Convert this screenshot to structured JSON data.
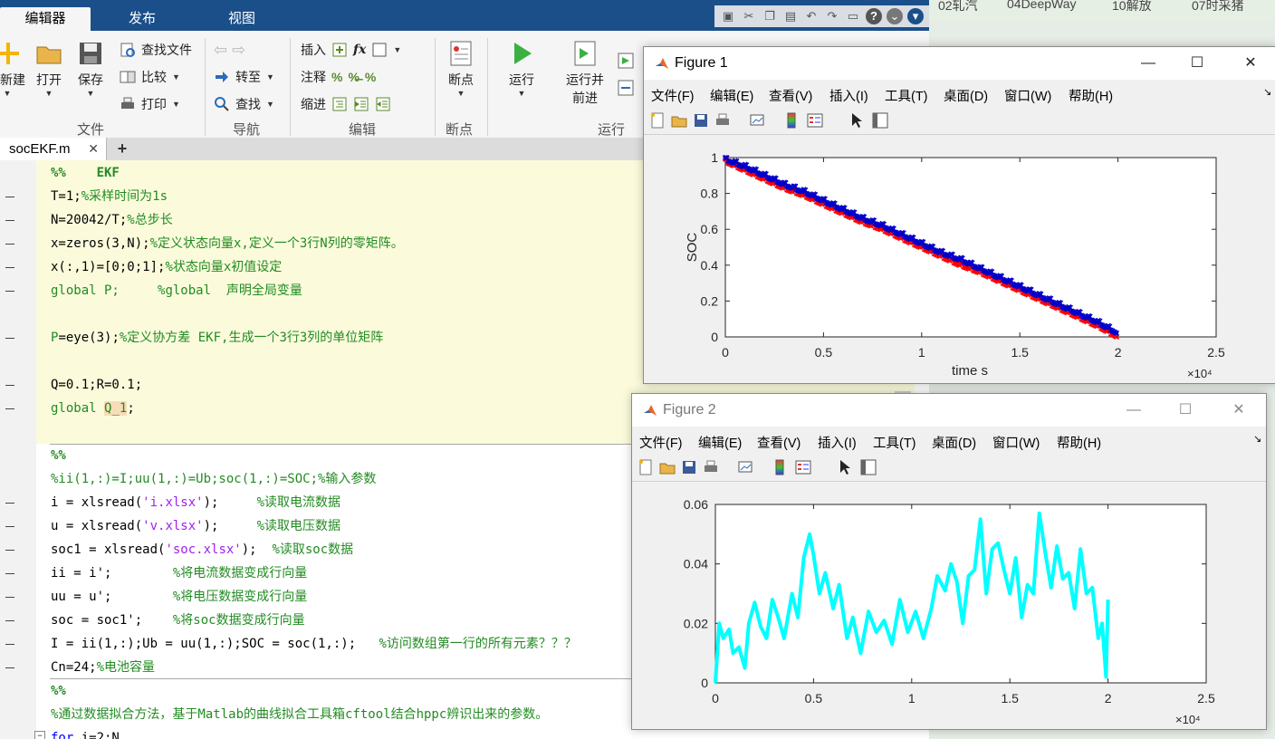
{
  "ribbon": {
    "tabs": [
      "编辑器",
      "发布",
      "视图"
    ],
    "file_group": {
      "new": "新建",
      "open": "打开",
      "save": "保存",
      "find_files": "查找文件",
      "compare": "比较",
      "print": "打印",
      "label": "文件"
    },
    "nav_group": {
      "goto": "转至",
      "find": "查找",
      "label": "导航"
    },
    "edit_group": {
      "insert": "插入",
      "comment": "注释",
      "indent": "缩进",
      "label": "编辑",
      "fx": "fx"
    },
    "bp_group": {
      "breakpoints": "断点",
      "label": "断点"
    },
    "run_group": {
      "run": "运行",
      "run_advance_1": "运行并",
      "run_advance_2": "前进",
      "label": "运行"
    }
  },
  "editor": {
    "file_tab": "socEKF.m",
    "add_tab": "+",
    "lines": [
      {
        "segments": [
          {
            "t": "%%    EKF",
            "c": "cmt bold"
          }
        ],
        "dash": false
      },
      {
        "segments": [
          {
            "t": "T=1;",
            "c": ""
          },
          {
            "t": "%采样时间为1s",
            "c": "cmt"
          }
        ],
        "dash": true
      },
      {
        "segments": [
          {
            "t": "N=20042/T;",
            "c": ""
          },
          {
            "t": "%总步长",
            "c": "cmt"
          }
        ],
        "dash": true
      },
      {
        "segments": [
          {
            "t": "x=zeros(3,N);",
            "c": ""
          },
          {
            "t": "%定义状态向量x,定义一个3行N列的零矩阵。",
            "c": "cmt"
          }
        ],
        "dash": true
      },
      {
        "segments": [
          {
            "t": "x(:,1)=[0;0;1];",
            "c": ""
          },
          {
            "t": "%状态向量x初值设定",
            "c": "cmt"
          }
        ],
        "dash": true
      },
      {
        "segments": [
          {
            "t": "global P;     ",
            "c": "cmt"
          },
          {
            "t": "%global  声明全局变量",
            "c": "cmt"
          }
        ],
        "dash": true
      },
      {
        "segments": [
          {
            "t": "",
            "c": ""
          }
        ],
        "dash": false
      },
      {
        "segments": [
          {
            "t": "P",
            "c": "cmt"
          },
          {
            "t": "=eye(3);",
            "c": ""
          },
          {
            "t": "%定义协方差 EKF,生成一个3行3列的单位矩阵",
            "c": "cmt"
          }
        ],
        "dash": true
      },
      {
        "segments": [
          {
            "t": "",
            "c": ""
          }
        ],
        "dash": false
      },
      {
        "segments": [
          {
            "t": "Q=0.1;R=0.1;",
            "c": ""
          }
        ],
        "dash": true
      },
      {
        "segments": [
          {
            "t": "global ",
            "c": "cmt"
          },
          {
            "t": "Q_1",
            "c": "hl"
          },
          {
            "t": ";",
            "c": ""
          }
        ],
        "dash": true
      },
      {
        "segments": [
          {
            "t": "",
            "c": ""
          }
        ],
        "dash": false
      },
      {
        "segments": [
          {
            "t": "%%",
            "c": "cmt bold"
          }
        ],
        "dash": false
      },
      {
        "segments": [
          {
            "t": "%ii(1,:)=I;uu(1,:)=Ub;soc(1,:)=SOC;%输入参数",
            "c": "cmt"
          }
        ],
        "dash": false
      },
      {
        "segments": [
          {
            "t": "i = xlsread(",
            "c": ""
          },
          {
            "t": "'i.xlsx'",
            "c": "str"
          },
          {
            "t": ");     ",
            "c": ""
          },
          {
            "t": "%读取电流数据",
            "c": "cmt"
          }
        ],
        "dash": true
      },
      {
        "segments": [
          {
            "t": "u = xlsread(",
            "c": ""
          },
          {
            "t": "'v.xlsx'",
            "c": "str"
          },
          {
            "t": ");     ",
            "c": ""
          },
          {
            "t": "%读取电压数据",
            "c": "cmt"
          }
        ],
        "dash": true
      },
      {
        "segments": [
          {
            "t": "soc1 = xlsread(",
            "c": ""
          },
          {
            "t": "'soc.xlsx'",
            "c": "str"
          },
          {
            "t": ");  ",
            "c": ""
          },
          {
            "t": "%读取soc数据",
            "c": "cmt"
          }
        ],
        "dash": true
      },
      {
        "segments": [
          {
            "t": "ii = i';        ",
            "c": ""
          },
          {
            "t": "%将电流数据变成行向量",
            "c": "cmt"
          }
        ],
        "dash": true
      },
      {
        "segments": [
          {
            "t": "uu = u';        ",
            "c": ""
          },
          {
            "t": "%将电压数据变成行向量",
            "c": "cmt"
          }
        ],
        "dash": true
      },
      {
        "segments": [
          {
            "t": "soc = soc1';    ",
            "c": ""
          },
          {
            "t": "%将soc数据变成行向量",
            "c": "cmt"
          }
        ],
        "dash": true
      },
      {
        "segments": [
          {
            "t": "I = ii(1,:);Ub = uu(1,:);SOC = soc(1,:);   ",
            "c": ""
          },
          {
            "t": "%访问数组第一行的所有元素？？？",
            "c": "cmt"
          }
        ],
        "dash": true
      },
      {
        "segments": [
          {
            "t": "Cn=24;",
            "c": ""
          },
          {
            "t": "%电池容量",
            "c": "cmt"
          }
        ],
        "dash": true
      },
      {
        "segments": [
          {
            "t": "%%",
            "c": "cmt bold"
          }
        ],
        "dash": false
      },
      {
        "segments": [
          {
            "t": "%通过数据拟合方法，基于Matlab的曲线拟合工具箱cftool结合hppc辨识出来的参数。",
            "c": "cmt"
          }
        ],
        "dash": false
      },
      {
        "segments": [
          {
            "t": "for ",
            "c": "kw"
          },
          {
            "t": "i=2:N",
            "c": ""
          }
        ],
        "dash": false
      }
    ]
  },
  "background_bar": [
    "02轧汽",
    "04DeepWay",
    "10解放",
    "07时采猪"
  ],
  "figure1": {
    "title": "Figure 1",
    "menu": [
      "文件(F)",
      "编辑(E)",
      "查看(V)",
      "插入(I)",
      "工具(T)",
      "桌面(D)",
      "窗口(W)",
      "帮助(H)"
    ],
    "chart": {
      "xlabel": "time  s",
      "ylabel": "SOC",
      "xticks": [
        "0",
        "0.5",
        "1",
        "1.5",
        "2",
        "2.5"
      ],
      "yticks": [
        "0",
        "0.2",
        "0.4",
        "0.6",
        "0.8",
        "1"
      ],
      "exponent": "×10⁴"
    }
  },
  "figure2": {
    "title": "Figure 2",
    "menu": [
      "文件(F)",
      "编辑(E)",
      "查看(V)",
      "插入(I)",
      "工具(T)",
      "桌面(D)",
      "窗口(W)",
      "帮助(H)"
    ],
    "chart": {
      "xticks": [
        "0",
        "0.5",
        "1",
        "1.5",
        "2",
        "2.5"
      ],
      "yticks": [
        "0",
        "0.02",
        "0.04",
        "0.06"
      ],
      "exponent": "×10⁴"
    }
  },
  "colors": {
    "ribbon_blue": "#1b4f89",
    "cell_yellow": "#fbfbdc",
    "comment_green": "#228b22",
    "soc_true": "#ff0000",
    "soc_est": "#0000cc",
    "error_cyan": "#00ffff"
  },
  "chart_data": [
    {
      "type": "scatter",
      "title": "",
      "xlabel": "time  s",
      "ylabel": "SOC",
      "xlim": [
        0,
        25000
      ],
      "ylim": [
        0,
        1
      ],
      "series": [
        {
          "name": "",
          "color": "#ff0000",
          "x": [
            0,
            1000,
            2000,
            3000,
            4000,
            5000,
            6000,
            7000,
            8000,
            9000,
            10000,
            11000,
            12000,
            13000,
            14000,
            15000,
            16000,
            17000,
            18000,
            19000,
            20000
          ],
          "values": [
            0.98,
            0.93,
            0.88,
            0.83,
            0.79,
            0.74,
            0.69,
            0.64,
            0.6,
            0.55,
            0.5,
            0.45,
            0.4,
            0.36,
            0.31,
            0.26,
            0.21,
            0.16,
            0.11,
            0.06,
            0.0
          ]
        },
        {
          "name": "",
          "color": "#0000cc",
          "x": [
            0,
            1000,
            2000,
            3000,
            4000,
            5000,
            6000,
            7000,
            8000,
            9000,
            10000,
            11000,
            12000,
            13000,
            14000,
            15000,
            16000,
            17000,
            18000,
            19000,
            20000
          ],
          "values": [
            0.99,
            0.95,
            0.9,
            0.85,
            0.81,
            0.76,
            0.71,
            0.66,
            0.62,
            0.57,
            0.52,
            0.47,
            0.43,
            0.38,
            0.33,
            0.28,
            0.23,
            0.18,
            0.13,
            0.08,
            0.02
          ]
        }
      ]
    },
    {
      "type": "line",
      "title": "",
      "xlim": [
        0,
        25000
      ],
      "ylim": [
        0,
        0.06
      ],
      "series": [
        {
          "name": "",
          "color": "#00ffff",
          "x": [
            0,
            200,
            400,
            700,
            900,
            1200,
            1500,
            1700,
            2000,
            2300,
            2600,
            2900,
            3200,
            3500,
            3900,
            4200,
            4500,
            4800,
            5000,
            5300,
            5600,
            6000,
            6300,
            6700,
            7000,
            7400,
            7800,
            8200,
            8600,
            9000,
            9400,
            9800,
            10200,
            10600,
            11000,
            11300,
            11700,
            12000,
            12300,
            12600,
            12900,
            13200,
            13500,
            13800,
            14100,
            14400,
            14700,
            15000,
            15300,
            15600,
            15900,
            16200,
            16500,
            16800,
            17100,
            17400,
            17700,
            18000,
            18300,
            18600,
            18900,
            19200,
            19500,
            19700,
            19900,
            20000
          ],
          "values": [
            0.0,
            0.02,
            0.015,
            0.018,
            0.01,
            0.012,
            0.005,
            0.02,
            0.027,
            0.019,
            0.015,
            0.028,
            0.022,
            0.015,
            0.03,
            0.022,
            0.042,
            0.05,
            0.043,
            0.03,
            0.037,
            0.025,
            0.033,
            0.015,
            0.022,
            0.01,
            0.024,
            0.017,
            0.021,
            0.013,
            0.028,
            0.017,
            0.024,
            0.015,
            0.025,
            0.036,
            0.031,
            0.04,
            0.034,
            0.02,
            0.036,
            0.038,
            0.055,
            0.03,
            0.045,
            0.047,
            0.038,
            0.03,
            0.042,
            0.022,
            0.033,
            0.03,
            0.057,
            0.044,
            0.032,
            0.046,
            0.035,
            0.037,
            0.025,
            0.045,
            0.03,
            0.032,
            0.015,
            0.02,
            0.002,
            0.028
          ]
        }
      ]
    }
  ]
}
